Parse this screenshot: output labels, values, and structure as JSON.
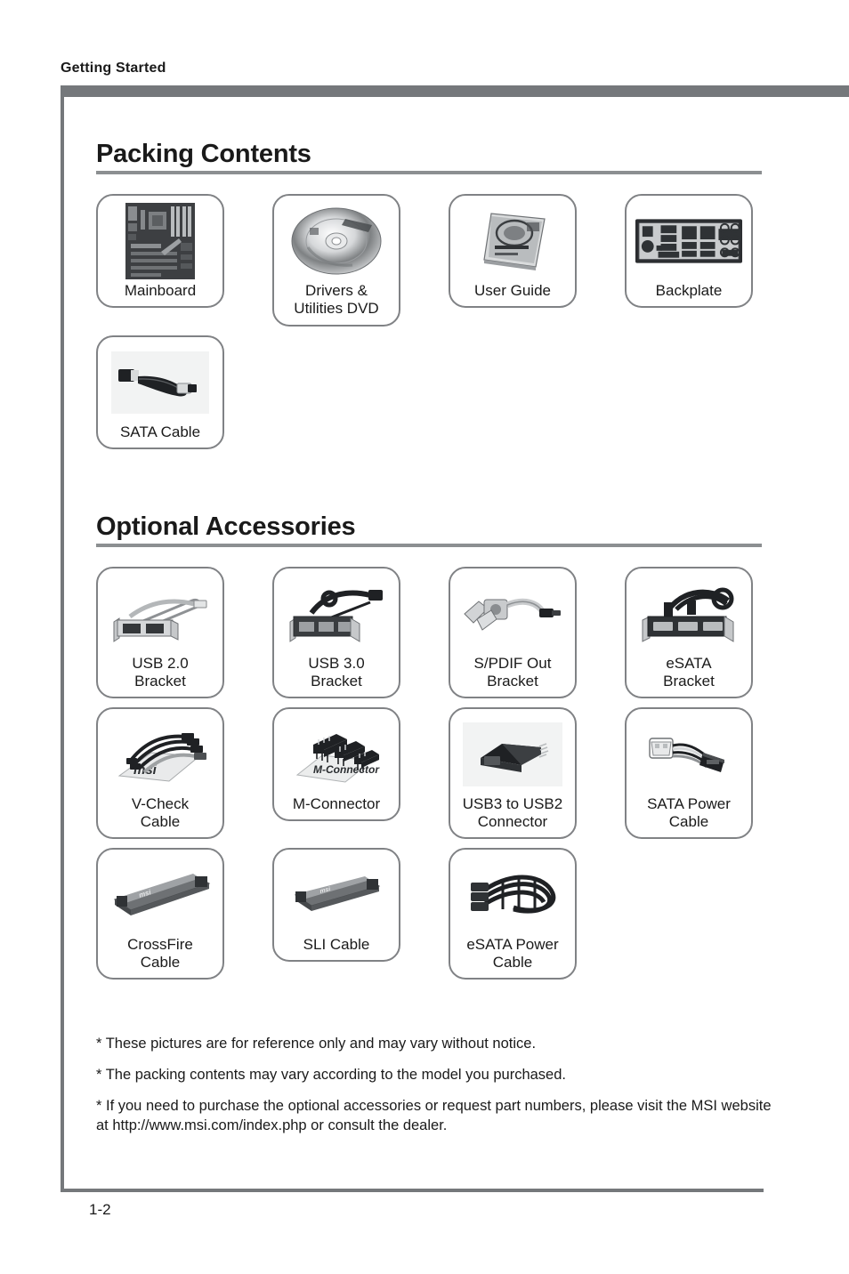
{
  "header": {
    "running_head": "Getting Started"
  },
  "sections": [
    {
      "title": "Packing Contents",
      "rows": [
        [
          {
            "label": "Mainboard",
            "art": "mainboard"
          },
          {
            "label": "Drivers &\nUtilities DVD",
            "art": "dvd"
          },
          {
            "label": "User Guide",
            "art": "user-guide"
          },
          {
            "label": "Backplate",
            "art": "backplate"
          }
        ],
        [
          {
            "label": "SATA Cable",
            "art": "sata-cable"
          }
        ]
      ]
    },
    {
      "title": "Optional Accessories",
      "rows": [
        [
          {
            "label": "USB 2.0\nBracket",
            "art": "usb2-bracket"
          },
          {
            "label": "USB 3.0\nBracket",
            "art": "usb3-bracket"
          },
          {
            "label": "S/PDIF Out\nBracket",
            "art": "spdif-bracket"
          },
          {
            "label": "eSATA\nBracket",
            "art": "esata-bracket"
          }
        ],
        [
          {
            "label": "V-Check\nCable",
            "art": "v-check-cable"
          },
          {
            "label": "M-Connector",
            "art": "m-connector"
          },
          {
            "label": "USB3 to USB2\nConnector",
            "art": "usb3-to-usb2"
          },
          {
            "label": "SATA Power\nCable",
            "art": "sata-power-cable"
          }
        ],
        [
          {
            "label": "CrossFire\nCable",
            "art": "crossfire-cable"
          },
          {
            "label": "SLI Cable",
            "art": "sli-cable"
          },
          {
            "label": "eSATA Power\nCable",
            "art": "esata-power-cable"
          }
        ]
      ]
    }
  ],
  "footnotes": [
    "* These pictures are for reference only and may vary without notice.",
    "* The packing contents may vary according to the model you purchased.",
    "* If you need to purchase the optional accessories or request part numbers, please visit the MSI website at http://www.msi.com/index.php or consult the dealer."
  ],
  "page_number": "1-2",
  "colors": {
    "rule": "#8c8f91",
    "frame": "#75787b",
    "card_border": "#808285",
    "text": "#1a1a1a"
  }
}
